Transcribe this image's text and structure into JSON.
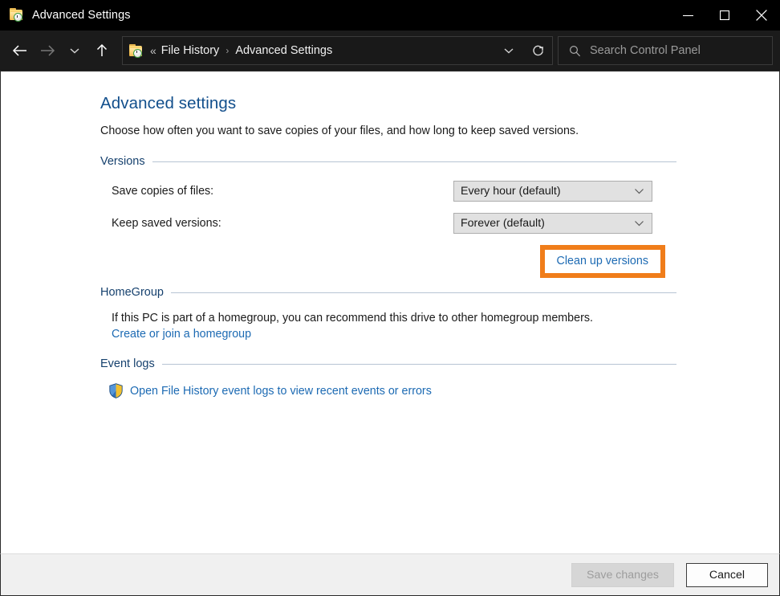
{
  "window": {
    "title": "Advanced Settings",
    "title_icon": "file-history-folder-icon",
    "minimize_label": "Minimize",
    "maximize_label": "Maximize",
    "close_label": "Close"
  },
  "toolbar": {
    "back_label": "Back",
    "forward_label": "Forward",
    "recent_label": "Recent locations",
    "up_label": "Up",
    "breadcrumb": {
      "icon": "file-history-folder-icon",
      "overflow": "«",
      "separator": "›",
      "items": [
        "File History",
        "Advanced Settings"
      ]
    },
    "dropdown_label": "Previous locations",
    "refresh_label": "Refresh",
    "search": {
      "icon": "search-icon",
      "placeholder": "Search Control Panel",
      "value": ""
    }
  },
  "page": {
    "title": "Advanced settings",
    "description": "Choose how often you want to save copies of your files, and how long to keep saved versions."
  },
  "versions": {
    "group_label": "Versions",
    "rows": [
      {
        "label": "Save copies of files:",
        "value": "Every hour (default)",
        "chevron": "chevron-down-icon"
      },
      {
        "label": "Keep saved versions:",
        "value": "Forever (default)",
        "chevron": "chevron-down-icon"
      }
    ],
    "cleanup_link": "Clean up versions",
    "highlight_color": "#f07d1a"
  },
  "homegroup": {
    "group_label": "HomeGroup",
    "description": "If this PC is part of a homegroup, you can recommend this drive to other homegroup members.",
    "link": "Create or join a homegroup"
  },
  "event_logs": {
    "group_label": "Event logs",
    "icon": "uac-shield-icon",
    "link": "Open File History event logs to view recent events or errors"
  },
  "footer": {
    "save_label": "Save changes",
    "save_enabled": "false",
    "cancel_label": "Cancel"
  },
  "colors": {
    "accent_link": "#1c6ab3",
    "group_header": "#16416e",
    "page_title": "#124f8c",
    "highlight": "#f07d1a",
    "titlebar": "#000000",
    "toolbar": "#1b1b1b"
  }
}
